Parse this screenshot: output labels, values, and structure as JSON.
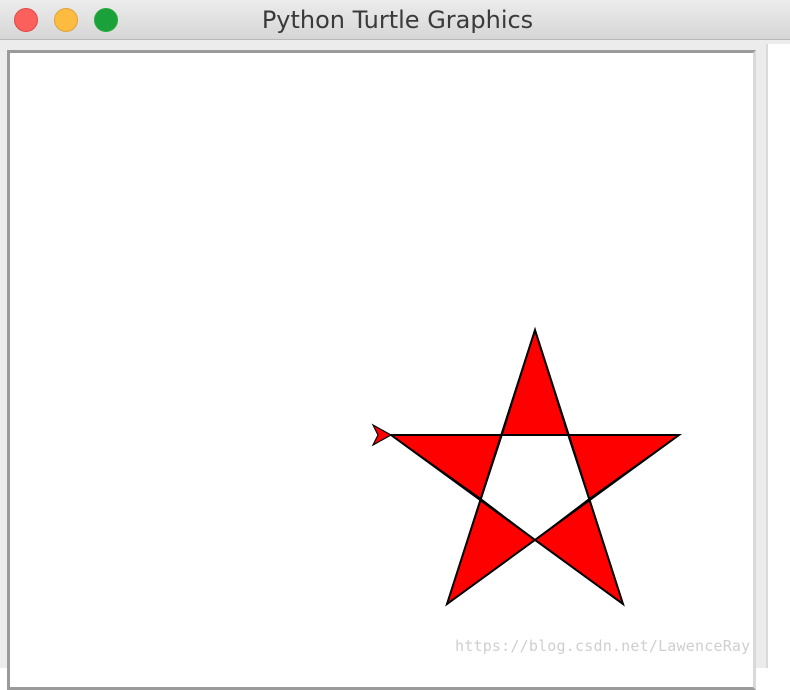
{
  "window": {
    "title": "Python Turtle Graphics"
  },
  "canvas": {
    "background": "#ffffff",
    "shape": {
      "type": "star",
      "fill_color": "#ff0000",
      "stroke_color": "#000000"
    },
    "turtle_color": "#ff0000"
  },
  "watermark": {
    "text": "https://blog.csdn.net/LawenceRay"
  }
}
